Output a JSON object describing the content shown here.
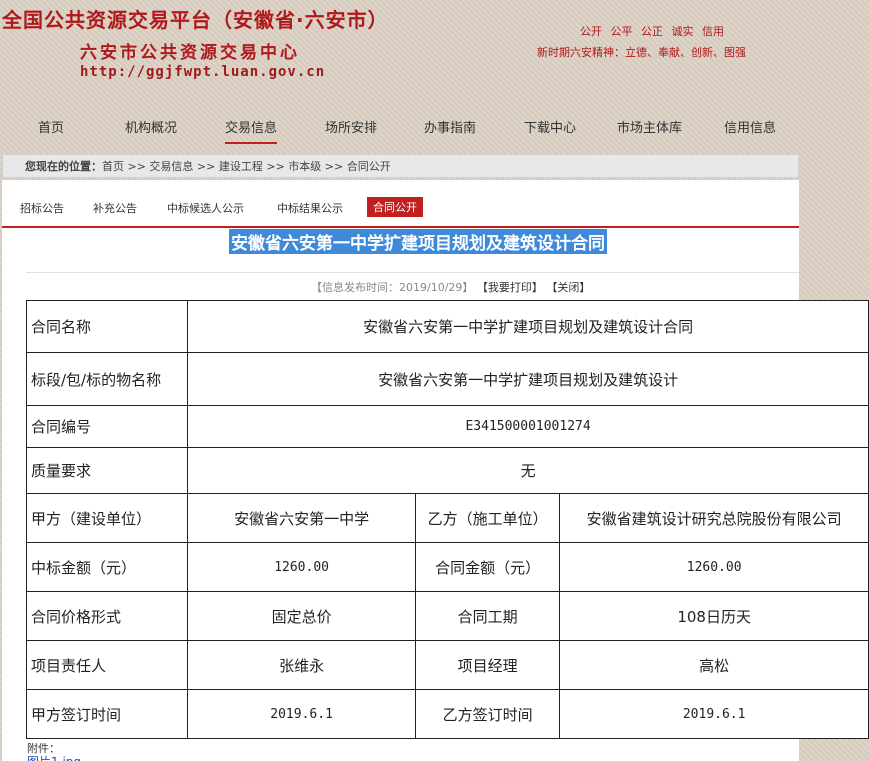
{
  "header": {
    "title": "全国公共资源交易平台（安徽省·六安市）",
    "subtitle": "六安市公共资源交易中心",
    "url": "http://ggjfwpt.luan.gov.cn",
    "values": "公开 公平 公正 诚实 信用",
    "spirit": "新时期六安精神：立德、奉献、创新、图强"
  },
  "nav": [
    "首页",
    "机构概况",
    "交易信息",
    "场所安排",
    "办事指南",
    "下载中心",
    "市场主体库",
    "信用信息"
  ],
  "breadcrumb": {
    "prefix": "您现在的位置：",
    "path": "首页 >> 交易信息 >> 建设工程 >> 市本级 >> 合同公开"
  },
  "tabs": [
    "招标公告",
    "补充公告",
    "中标候选人公示",
    "中标结果公示",
    "合同公开"
  ],
  "active_tab": "合同公开",
  "article": {
    "title": "安徽省六安第一中学扩建项目规划及建筑设计合同",
    "meta_time": "【信息发布时间：2019/10/29】",
    "print_label": "【我要打印】",
    "close_label": "【关闭】"
  },
  "contract": {
    "name_label": "合同名称",
    "name": "安徽省六安第一中学扩建项目规划及建筑设计合同",
    "subject_label": "标段/包/标的物名称",
    "subject": "安徽省六安第一中学扩建项目规划及建筑设计",
    "number_label": "合同编号",
    "number": "E341500001001274",
    "quality_label": "质量要求",
    "quality": "无",
    "party_a_label": "甲方（建设单位）",
    "party_a": "安徽省六安第一中学",
    "party_b_label": "乙方（施工单位）",
    "party_b": "安徽省建筑设计研究总院股份有限公司",
    "bid_amount_label": "中标金额（元）",
    "bid_amount": "1260.00",
    "contract_amount_label": "合同金额（元）",
    "contract_amount": "1260.00",
    "price_form_label": "合同价格形式",
    "price_form": "固定总价",
    "period_label": "合同工期",
    "period": "108日历天",
    "leader_label": "项目责任人",
    "leader": "张维永",
    "manager_label": "项目经理",
    "manager": "高松",
    "a_sign_label": "甲方签订时间",
    "a_sign": "2019.6.1",
    "b_sign_label": "乙方签订时间",
    "b_sign": "2019.6.1"
  },
  "attachments": {
    "label": "附件：",
    "file": "图片1.jpg"
  },
  "colors": {
    "brand_red": "#b0191c",
    "highlight_blue": "#3f8ad8",
    "tab_active": "#c0201f"
  }
}
